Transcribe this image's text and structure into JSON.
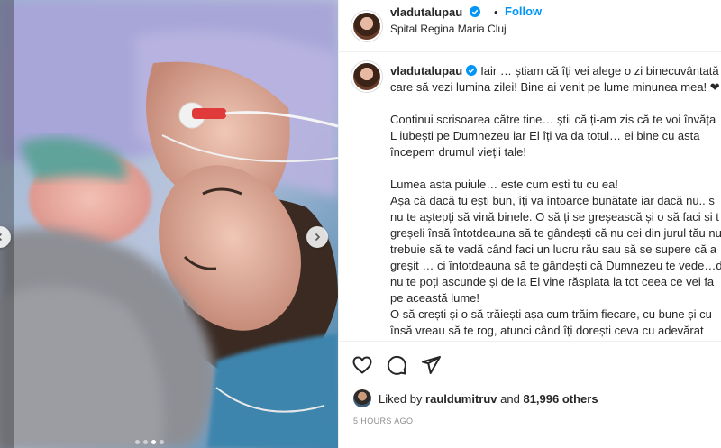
{
  "post": {
    "username": "vladutalupau",
    "bullet": "•",
    "follow_label": "Follow",
    "location": "Spital Regina Maria Cluj"
  },
  "caption": {
    "username": "vladutalupau",
    "text": "Iair … știam că îți vei alege o zi binecuvântată\ncare să vezi lumina zilei! Bine ai venit pe lume minunea mea! ❤\n\nContinui scrisoarea către tine… știi că ți-am zis că te voi învăța\nL iubești pe Dumnezeu iar El îți va da totul… ei bine cu asta\nîncepem drumul vieții tale!\n\nLumea asta puiule… este cum ești tu cu ea!\nAșa că dacă tu ești bun, îți va întoarce bunătate iar dacă nu.. s\nnu te aștepți să vină binele. O să ți se greșească și o să faci și t\ngreșeli însă întotdeauna să te gândești că nu cei din jurul tău nu\ntrebuie să te vadă când faci un lucru rău sau să se supere că a\ngreșit … ci întotdeauna să te gândești că Dumnezeu te vede…de\nnu te poți ascunde și de la El vine răsplata la tot ceea ce vei fa\npe această lume!\nO să crești și o să trăiești așa cum trăim fiecare, cu bune și cu\nînsă vreau să te rog, atunci când îți dorești ceva cu adevărat\nLUPTĂ și nu renunța niciodată, iar eu… voi fi lângă tine"
  },
  "likes": {
    "prefix": "Liked by ",
    "user": "rauldumitruv",
    "middle": " and ",
    "count": "81,996 others"
  },
  "timestamp": "5 HOURS AGO",
  "icons": {
    "like": "heart-icon",
    "comment": "comment-icon",
    "share": "share-icon",
    "verified": "verified-badge-icon",
    "next": "chevron-right-icon",
    "prev": "chevron-left-icon"
  },
  "colors": {
    "follow": "#0095f6",
    "verified": "#0095f6",
    "muted": "#8e8e8e"
  },
  "carousel": {
    "total": 4,
    "active_index": 2
  }
}
